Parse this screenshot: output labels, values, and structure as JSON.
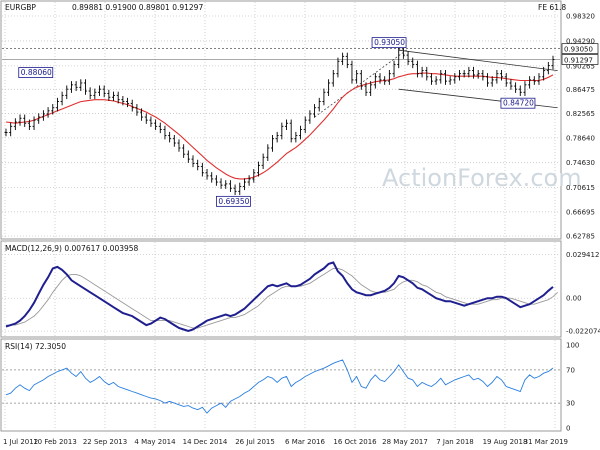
{
  "chart_data": {
    "type": "line",
    "symbol": "EURGBP",
    "timeframe": "Weekly",
    "header_quote": "0.89881 0.91900 0.89801 0.91297",
    "fe_label": "FE 61.8",
    "watermark": "ActionForex.com",
    "colors": {
      "price": "#000000",
      "sma": "#e03030",
      "macd": "#1f1f8f",
      "macd_signal": "#9a9a9a",
      "rsi": "#2a7fe0",
      "tag_border": "#1a1a8c",
      "grid": "#c8c8c8"
    },
    "x_ticks": [
      "1 Jul 2012",
      "10 Feb 2013",
      "22 Sep 2013",
      "4 May 2014",
      "14 Dec 2014",
      "26 Jul 2015",
      "6 Mar 2016",
      "16 Oct 2016",
      "28 May 2017",
      "7 Jan 2018",
      "19 Aug 2018",
      "31 Mar 2019"
    ],
    "price_panel": {
      "yticks": [
        "0.98320",
        "0.94290",
        "0.90265",
        "0.86475",
        "0.82565",
        "0.78640",
        "0.74630",
        "0.70615",
        "0.66695",
        "0.62785"
      ],
      "ylim": [
        0.62785,
        0.9832
      ],
      "price_label": "0.91297",
      "resistance_label": "0.93050",
      "close": [
        0.795,
        0.805,
        0.812,
        0.818,
        0.81,
        0.805,
        0.815,
        0.82,
        0.825,
        0.83,
        0.835,
        0.845,
        0.855,
        0.865,
        0.872,
        0.868,
        0.875,
        0.862,
        0.855,
        0.86,
        0.865,
        0.858,
        0.852,
        0.855,
        0.848,
        0.845,
        0.842,
        0.835,
        0.828,
        0.82,
        0.815,
        0.81,
        0.805,
        0.8,
        0.79,
        0.785,
        0.778,
        0.77,
        0.76,
        0.752,
        0.745,
        0.74,
        0.73,
        0.725,
        0.72,
        0.715,
        0.71,
        0.712,
        0.705,
        0.7,
        0.708,
        0.715,
        0.72,
        0.73,
        0.742,
        0.755,
        0.77,
        0.785,
        0.79,
        0.805,
        0.81,
        0.785,
        0.79,
        0.8,
        0.815,
        0.825,
        0.835,
        0.845,
        0.86,
        0.875,
        0.89,
        0.91,
        0.918,
        0.905,
        0.88,
        0.89,
        0.87,
        0.86,
        0.872,
        0.885,
        0.88,
        0.878,
        0.89,
        0.905,
        0.93,
        0.92,
        0.91,
        0.905,
        0.89,
        0.895,
        0.885,
        0.878,
        0.88,
        0.89,
        0.878,
        0.88,
        0.885,
        0.89,
        0.89,
        0.895,
        0.888,
        0.89,
        0.885,
        0.875,
        0.88,
        0.89,
        0.885,
        0.875,
        0.87,
        0.865,
        0.86,
        0.872,
        0.88,
        0.878,
        0.885,
        0.895,
        0.903,
        0.91297
      ],
      "sma": [
        0.812,
        0.811,
        0.81,
        0.811,
        0.812,
        0.813,
        0.815,
        0.818,
        0.821,
        0.824,
        0.827,
        0.83,
        0.833,
        0.836,
        0.839,
        0.842,
        0.845,
        0.846,
        0.847,
        0.848,
        0.848,
        0.848,
        0.847,
        0.846,
        0.844,
        0.842,
        0.84,
        0.837,
        0.834,
        0.831,
        0.828,
        0.824,
        0.82,
        0.815,
        0.81,
        0.804,
        0.798,
        0.792,
        0.785,
        0.778,
        0.771,
        0.764,
        0.757,
        0.75,
        0.744,
        0.738,
        0.733,
        0.728,
        0.724,
        0.721,
        0.72,
        0.72,
        0.721,
        0.723,
        0.726,
        0.73,
        0.735,
        0.741,
        0.747,
        0.754,
        0.761,
        0.766,
        0.771,
        0.777,
        0.784,
        0.791,
        0.799,
        0.807,
        0.815,
        0.824,
        0.833,
        0.843,
        0.852,
        0.859,
        0.864,
        0.868,
        0.871,
        0.873,
        0.875,
        0.877,
        0.878,
        0.879,
        0.88,
        0.882,
        0.885,
        0.887,
        0.889,
        0.89,
        0.89,
        0.891,
        0.891,
        0.89,
        0.89,
        0.889,
        0.888,
        0.887,
        0.886,
        0.886,
        0.886,
        0.886,
        0.886,
        0.886,
        0.886,
        0.885,
        0.884,
        0.884,
        0.883,
        0.882,
        0.881,
        0.88,
        0.879,
        0.879,
        0.879,
        0.879,
        0.879,
        0.881,
        0.884,
        0.888
      ],
      "annotations": [
        {
          "label": "0.88060",
          "idx": 10,
          "value": 0.8806
        },
        {
          "label": "0.69350",
          "idx": 51,
          "value": 0.6935
        },
        {
          "label": "0.93050",
          "idx": 86,
          "value": 0.9305
        },
        {
          "label": "0.84720",
          "idx": 111,
          "value": 0.8472
        }
      ],
      "channel": {
        "upper": [
          [
            84,
            0.928
          ],
          [
            118,
            0.895
          ]
        ],
        "lower": [
          [
            84,
            0.865
          ],
          [
            118,
            0.835
          ]
        ]
      },
      "dotted_trend": [
        [
          66,
          0.82
        ],
        [
          86,
          0.93
        ]
      ],
      "resistance_level": 0.9305
    },
    "macd_panel": {
      "label": "MACD(12,26,9) 0.007617 0.003958",
      "yticks": [
        "0.029412",
        "0.00",
        "-0.022074"
      ],
      "ylim": [
        -0.024,
        0.031
      ],
      "macd": [
        -0.019,
        -0.018,
        -0.017,
        -0.015,
        -0.012,
        -0.008,
        -0.003,
        0.003,
        0.009,
        0.014,
        0.02,
        0.021,
        0.019,
        0.016,
        0.012,
        0.01,
        0.008,
        0.006,
        0.004,
        0.002,
        0.0,
        -0.002,
        -0.004,
        -0.006,
        -0.008,
        -0.01,
        -0.011,
        -0.012,
        -0.014,
        -0.016,
        -0.018,
        -0.017,
        -0.015,
        -0.013,
        -0.014,
        -0.016,
        -0.018,
        -0.02,
        -0.021,
        -0.022,
        -0.021,
        -0.019,
        -0.017,
        -0.015,
        -0.014,
        -0.013,
        -0.012,
        -0.011,
        -0.012,
        -0.011,
        -0.009,
        -0.007,
        -0.004,
        -0.001,
        0.002,
        0.005,
        0.008,
        0.009,
        0.008,
        0.009,
        0.01,
        0.008,
        0.008,
        0.009,
        0.011,
        0.013,
        0.016,
        0.018,
        0.02,
        0.023,
        0.024,
        0.018,
        0.015,
        0.01,
        0.006,
        0.004,
        0.003,
        0.002,
        0.002,
        0.003,
        0.004,
        0.005,
        0.007,
        0.01,
        0.015,
        0.014,
        0.012,
        0.01,
        0.007,
        0.006,
        0.004,
        0.002,
        0.0,
        -0.001,
        -0.002,
        -0.002,
        -0.003,
        -0.004,
        -0.005,
        -0.004,
        -0.003,
        -0.002,
        -0.001,
        0.0,
        0.0,
        0.001,
        0.001,
        0.0,
        -0.002,
        -0.004,
        -0.006,
        -0.005,
        -0.004,
        -0.002,
        0.0,
        0.002,
        0.005,
        0.007617
      ],
      "signal": [
        -0.018,
        -0.018,
        -0.018,
        -0.017,
        -0.016,
        -0.014,
        -0.012,
        -0.009,
        -0.005,
        -0.001,
        0.004,
        0.008,
        0.012,
        0.015,
        0.016,
        0.016,
        0.015,
        0.013,
        0.011,
        0.009,
        0.007,
        0.005,
        0.003,
        0.001,
        -0.001,
        -0.003,
        -0.005,
        -0.007,
        -0.009,
        -0.011,
        -0.013,
        -0.015,
        -0.015,
        -0.015,
        -0.015,
        -0.015,
        -0.016,
        -0.017,
        -0.018,
        -0.019,
        -0.02,
        -0.02,
        -0.019,
        -0.018,
        -0.017,
        -0.016,
        -0.015,
        -0.014,
        -0.013,
        -0.013,
        -0.012,
        -0.011,
        -0.009,
        -0.007,
        -0.005,
        -0.002,
        0.001,
        0.003,
        0.005,
        0.007,
        0.008,
        0.008,
        0.008,
        0.008,
        0.009,
        0.01,
        0.012,
        0.014,
        0.016,
        0.018,
        0.02,
        0.02,
        0.019,
        0.017,
        0.015,
        0.012,
        0.009,
        0.007,
        0.005,
        0.004,
        0.004,
        0.004,
        0.005,
        0.006,
        0.009,
        0.011,
        0.012,
        0.012,
        0.011,
        0.009,
        0.008,
        0.006,
        0.004,
        0.003,
        0.001,
        0.0,
        -0.001,
        -0.002,
        -0.003,
        -0.004,
        -0.004,
        -0.004,
        -0.003,
        -0.002,
        -0.001,
        -0.001,
        0.0,
        0.0,
        0.0,
        -0.001,
        -0.002,
        -0.003,
        -0.004,
        -0.004,
        -0.003,
        -0.002,
        -0.001,
        0.001,
        0.003958
      ]
    },
    "rsi_panel": {
      "label": "RSI(14) 72.3050",
      "yticks": [
        "100",
        "70",
        "30",
        "0"
      ],
      "levels": [
        70,
        30
      ],
      "ylim": [
        0,
        100
      ],
      "rsi": [
        40,
        42,
        48,
        52,
        48,
        45,
        52,
        55,
        58,
        62,
        65,
        68,
        70,
        72,
        66,
        62,
        68,
        60,
        55,
        58,
        62,
        56,
        52,
        55,
        50,
        48,
        46,
        44,
        42,
        40,
        38,
        36,
        35,
        33,
        30,
        32,
        30,
        28,
        26,
        27,
        24,
        22,
        25,
        18,
        24,
        27,
        30,
        25,
        32,
        35,
        38,
        42,
        45,
        50,
        55,
        58,
        62,
        60,
        55,
        60,
        62,
        50,
        55,
        58,
        62,
        65,
        68,
        70,
        72,
        75,
        78,
        80,
        82,
        70,
        55,
        62,
        50,
        48,
        58,
        64,
        58,
        56,
        62,
        68,
        76,
        68,
        60,
        58,
        50,
        55,
        52,
        50,
        54,
        60,
        52,
        55,
        58,
        60,
        62,
        64,
        58,
        60,
        56,
        50,
        55,
        62,
        58,
        50,
        48,
        46,
        44,
        58,
        64,
        60,
        62,
        66,
        68,
        72.305
      ]
    }
  }
}
